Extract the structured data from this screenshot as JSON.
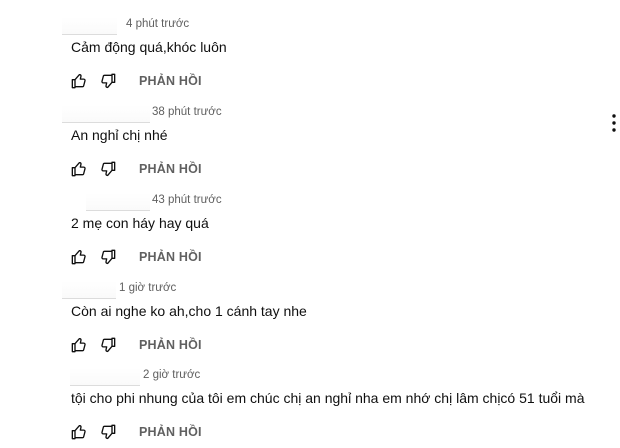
{
  "comments": [
    {
      "time": "4 phút trước",
      "text": "Cảm động quá,khóc luôn",
      "reply_label": "PHẢN HỒI"
    },
    {
      "time": "38 phút trước",
      "text": "An nghỉ chị nhé",
      "reply_label": "PHẢN HỒI"
    },
    {
      "time": "43 phút trước",
      "text": "2 mẹ con háy hay quá",
      "reply_label": "PHẢN HỒI"
    },
    {
      "time": "1 giờ trước",
      "text": "Còn ai nghe ko ah,cho 1 cánh tay nhe",
      "reply_label": "PHẢN HỒI"
    },
    {
      "time": "2 giờ trước",
      "text": "tội cho phi nhung của tôi em chúc chị an nghỉ nha em nhớ chị lâm chịcó 51 tuổi mà",
      "reply_label": "PHẢN HỒI"
    }
  ],
  "icons": {
    "like": "thumbs-up-outline",
    "dislike": "thumbs-down-outline",
    "more": "vertical-ellipsis"
  },
  "colors": {
    "text": "#0f0f0f",
    "secondary": "#606060",
    "background": "#ffffff"
  }
}
